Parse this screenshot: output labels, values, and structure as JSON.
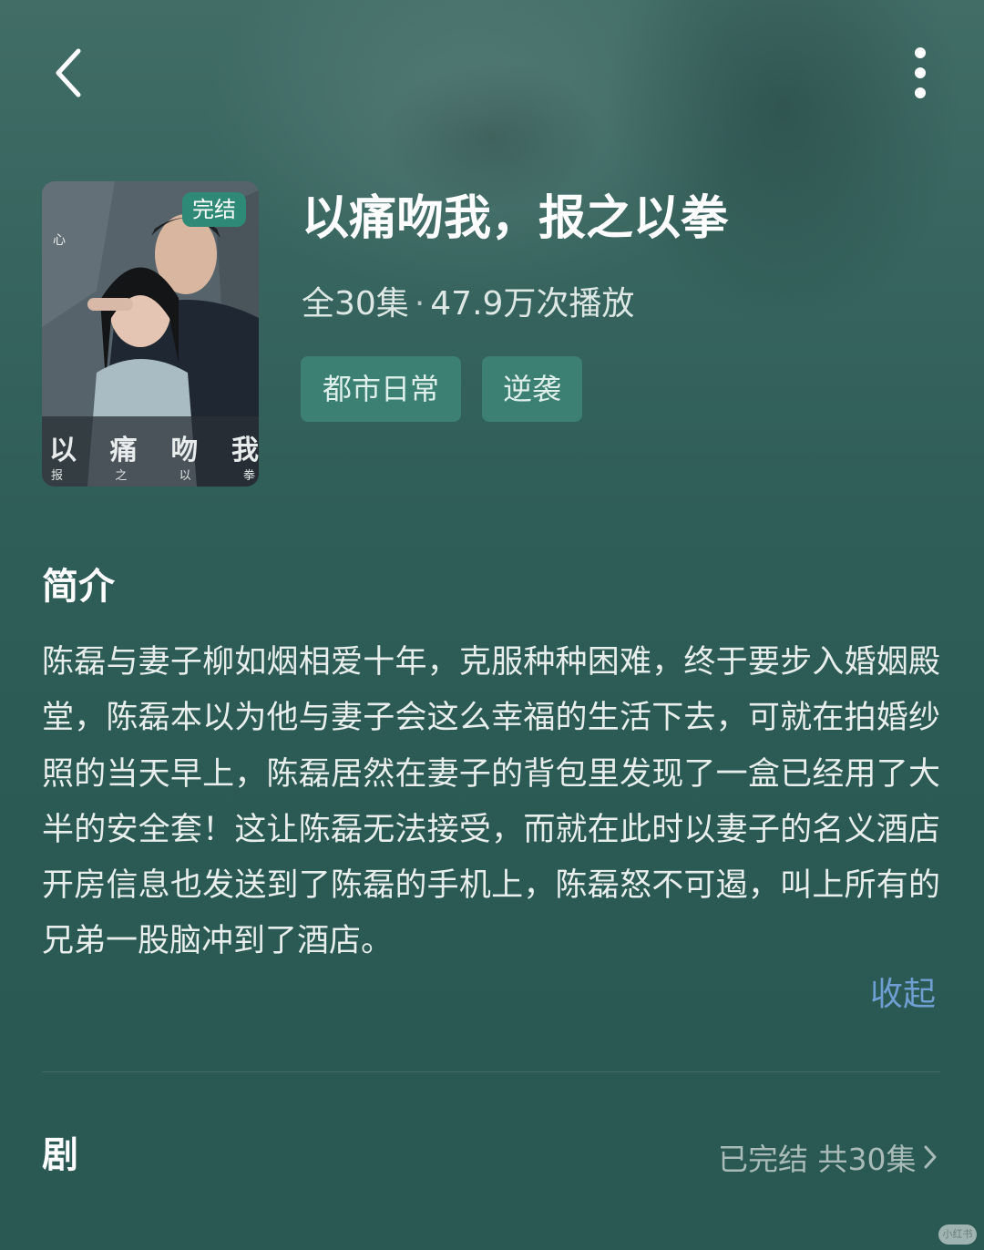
{
  "header": {
    "back_icon": "chevron-left-icon",
    "more_icon": "more-vertical-icon"
  },
  "drama": {
    "badge": "完结",
    "title": "以痛吻我，报之以拳",
    "episodes": "全30集",
    "separator": "·",
    "plays": "47.9万次播放",
    "tags": [
      "都市日常",
      "逆袭"
    ],
    "poster_title_chars": [
      "以",
      "痛",
      "吻",
      "我"
    ],
    "poster_sub_chars": [
      "报",
      "之",
      "以",
      "拳"
    ],
    "poster_top_text": "心"
  },
  "intro": {
    "heading": "简介",
    "text": "陈磊与妻子柳如烟相爱十年，克服种种困难，终于要步入婚姻殿堂，陈磊本以为他与妻子会这么幸福的生活下去，可就在拍婚纱照的当天早上，陈磊居然在妻子的背包里发现了一盒已经用了大半的安全套！这让陈磊无法接受，而就在此时以妻子的名义酒店开房信息也发送到了陈磊的手机上，陈磊怒不可遏，叫上所有的兄弟一股脑冲到了酒店。",
    "collapse_label": "收起"
  },
  "episodes_section": {
    "heading": "剧",
    "status": "已完结 共30集",
    "arrow_icon": "chevron-right-icon"
  },
  "watermark": "小红书",
  "colors": {
    "background": "#2c5b55",
    "badge": "#2e8a76",
    "tag_bg": "#3c7f73",
    "link": "#6f9fd2"
  }
}
